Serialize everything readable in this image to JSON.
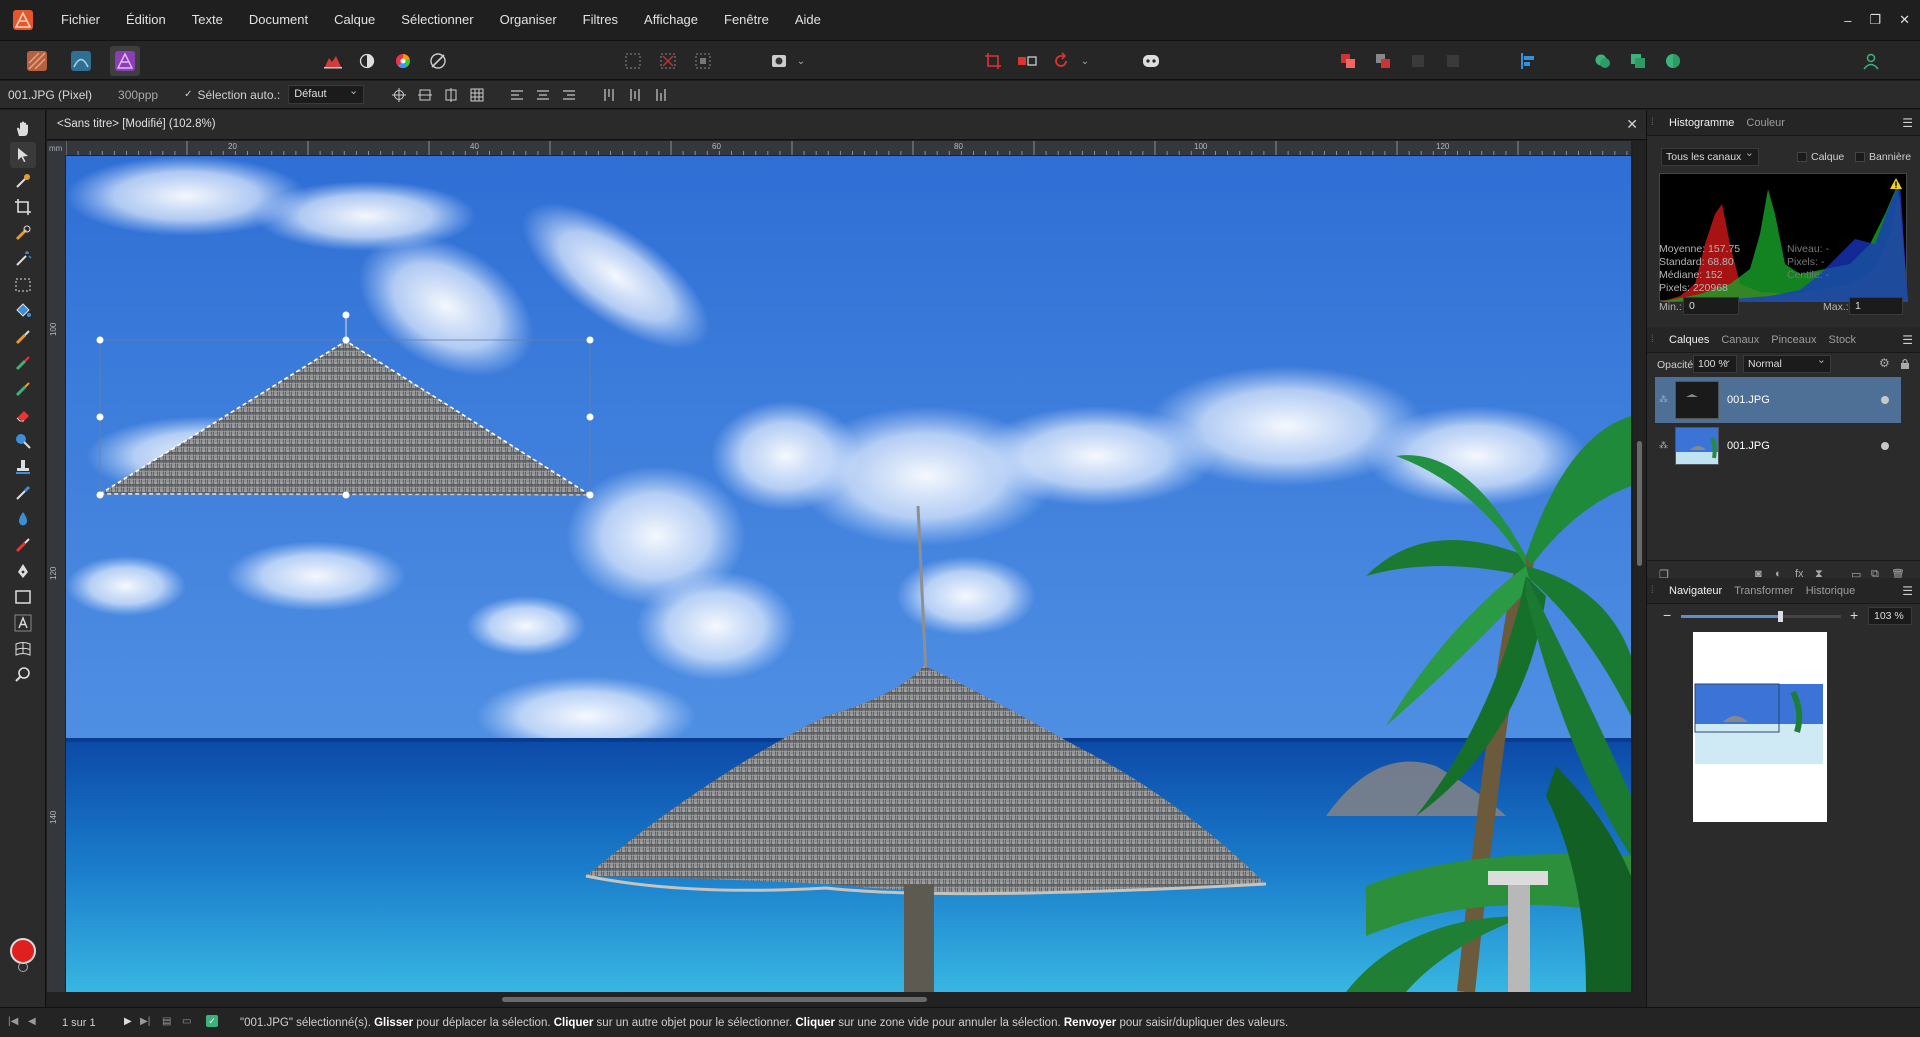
{
  "menu": [
    "Fichier",
    "Édition",
    "Texte",
    "Document",
    "Calque",
    "Sélectionner",
    "Organiser",
    "Filtres",
    "Affichage",
    "Fenêtre",
    "Aide"
  ],
  "window_controls": [
    "–",
    "❐",
    "✕"
  ],
  "context": {
    "file": "001.JPG (Pixel)",
    "dpi": "300ppp",
    "auto_select_label": "Sélection auto.:",
    "auto_select_value": "Défaut"
  },
  "document": {
    "tab_title": "<Sans titre> [Modifié] (102.8%)",
    "close": "✕"
  },
  "rulers": {
    "unit": "mm",
    "h_ticks": [
      "20",
      "40",
      "60",
      "80",
      "100",
      "120"
    ],
    "v_ticks": [
      "100",
      "120",
      "140"
    ]
  },
  "histogram": {
    "tabs": [
      "Histogramme",
      "Couleur"
    ],
    "channels": "Tous les canaux",
    "layer_label": "Calque",
    "banner_label": "Bannière",
    "stats": {
      "mean": "Moyenne: 157.75",
      "std": "Standard: 68.80",
      "median": "Médiane: 152",
      "pixels": "Pixels: 220968",
      "level": "Niveau: -",
      "pixels2": "Pixels: -",
      "centile": "Centile: -"
    },
    "min_label": "Min.:",
    "min_value": "0",
    "max_label": "Max.:",
    "max_value": "1"
  },
  "layers": {
    "tabs": [
      "Calques",
      "Canaux",
      "Pinceaux",
      "Stock"
    ],
    "opacity_label": "Opacité:",
    "opacity_value": "100 %",
    "blend_mode": "Normal",
    "items": [
      {
        "name": "001.JPG",
        "selected": true
      },
      {
        "name": "001.JPG",
        "selected": false
      }
    ]
  },
  "navigator": {
    "tabs": [
      "Navigateur",
      "Transformer",
      "Historique"
    ],
    "zoom": "103 %",
    "zoom_level": 0.62
  },
  "status": {
    "page": "1 sur 1",
    "msg_1": "\"001.JPG\" sélectionné(s). ",
    "msg_glisser": "Glisser",
    "msg_2": " pour déplacer la sélection. ",
    "msg_cliquer1": "Cliquer",
    "msg_3": " sur un autre objet pour le sélectionner. ",
    "msg_cliquer2": "Cliquer",
    "msg_4": " sur une zone vide pour annuler la sélection. ",
    "msg_renvoyer": "Renvoyer",
    "msg_5": " pour saisir/dupliquer des valeurs."
  },
  "colors": {
    "accent": "#4e6f96",
    "fill_color": "#e0201e",
    "sky": "#3b74d6"
  }
}
